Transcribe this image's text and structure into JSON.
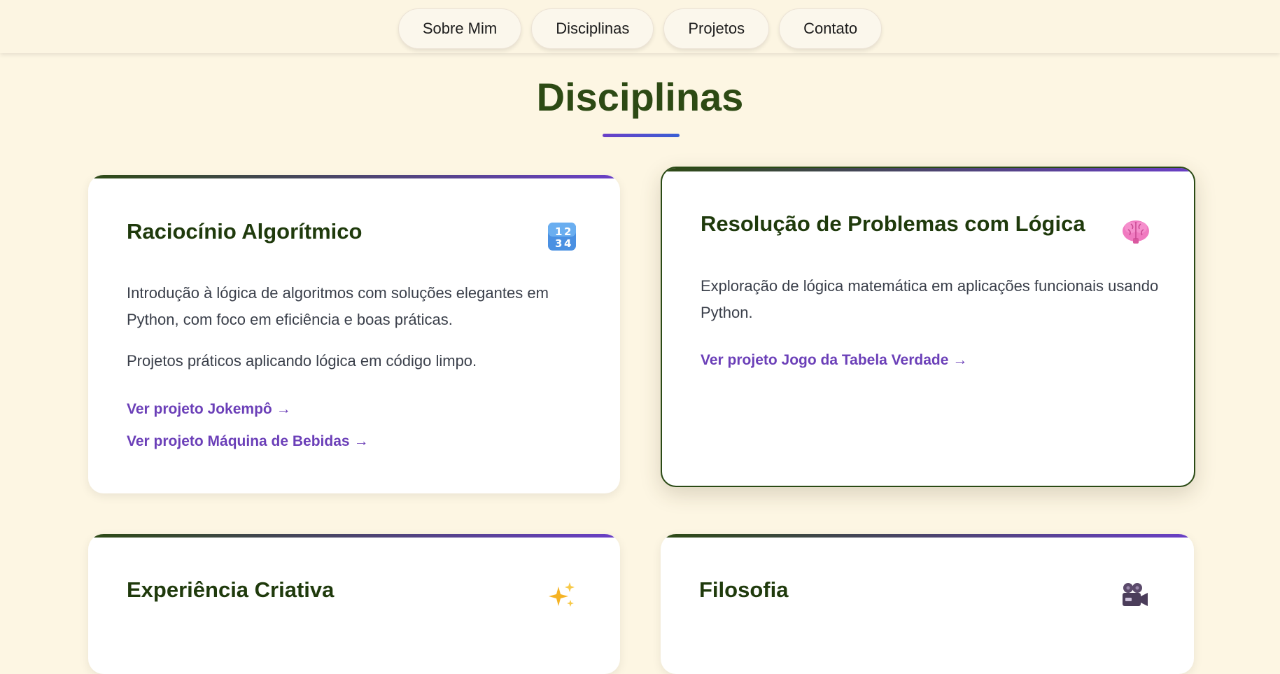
{
  "nav": {
    "items": [
      "Sobre Mim",
      "Disciplinas",
      "Projetos",
      "Contato"
    ]
  },
  "section": {
    "title": "Disciplinas"
  },
  "cards": [
    {
      "title": "Raciocínio Algorítmico",
      "icon": "numbers-1234-icon",
      "paragraphs": [
        "Introdução à lógica de algoritmos com soluções elegantes em Python, com foco em eficiência e boas práticas.",
        "Projetos práticos aplicando lógica em código limpo."
      ],
      "links": [
        "Ver projeto Jokempô",
        "Ver projeto Máquina de Bebidas"
      ]
    },
    {
      "title": "Resolução de Problemas com Lógica",
      "icon": "brain-icon",
      "paragraphs": [
        "Exploração de lógica matemática em aplicações funcionais usando Python."
      ],
      "links": [
        "Ver projeto Jogo da Tabela Verdade"
      ]
    },
    {
      "title": "Experiência Criativa",
      "icon": "sparkles-icon"
    },
    {
      "title": "Filosofia",
      "icon": "movie-camera-icon"
    }
  ],
  "link_arrow": "→",
  "colors": {
    "background": "#fdf6e3",
    "title_green": "#2d4a14",
    "link_purple": "#6b3fb8",
    "accent_gradient_start": "#2d4a14",
    "accent_gradient_end": "#6a3fc7"
  }
}
